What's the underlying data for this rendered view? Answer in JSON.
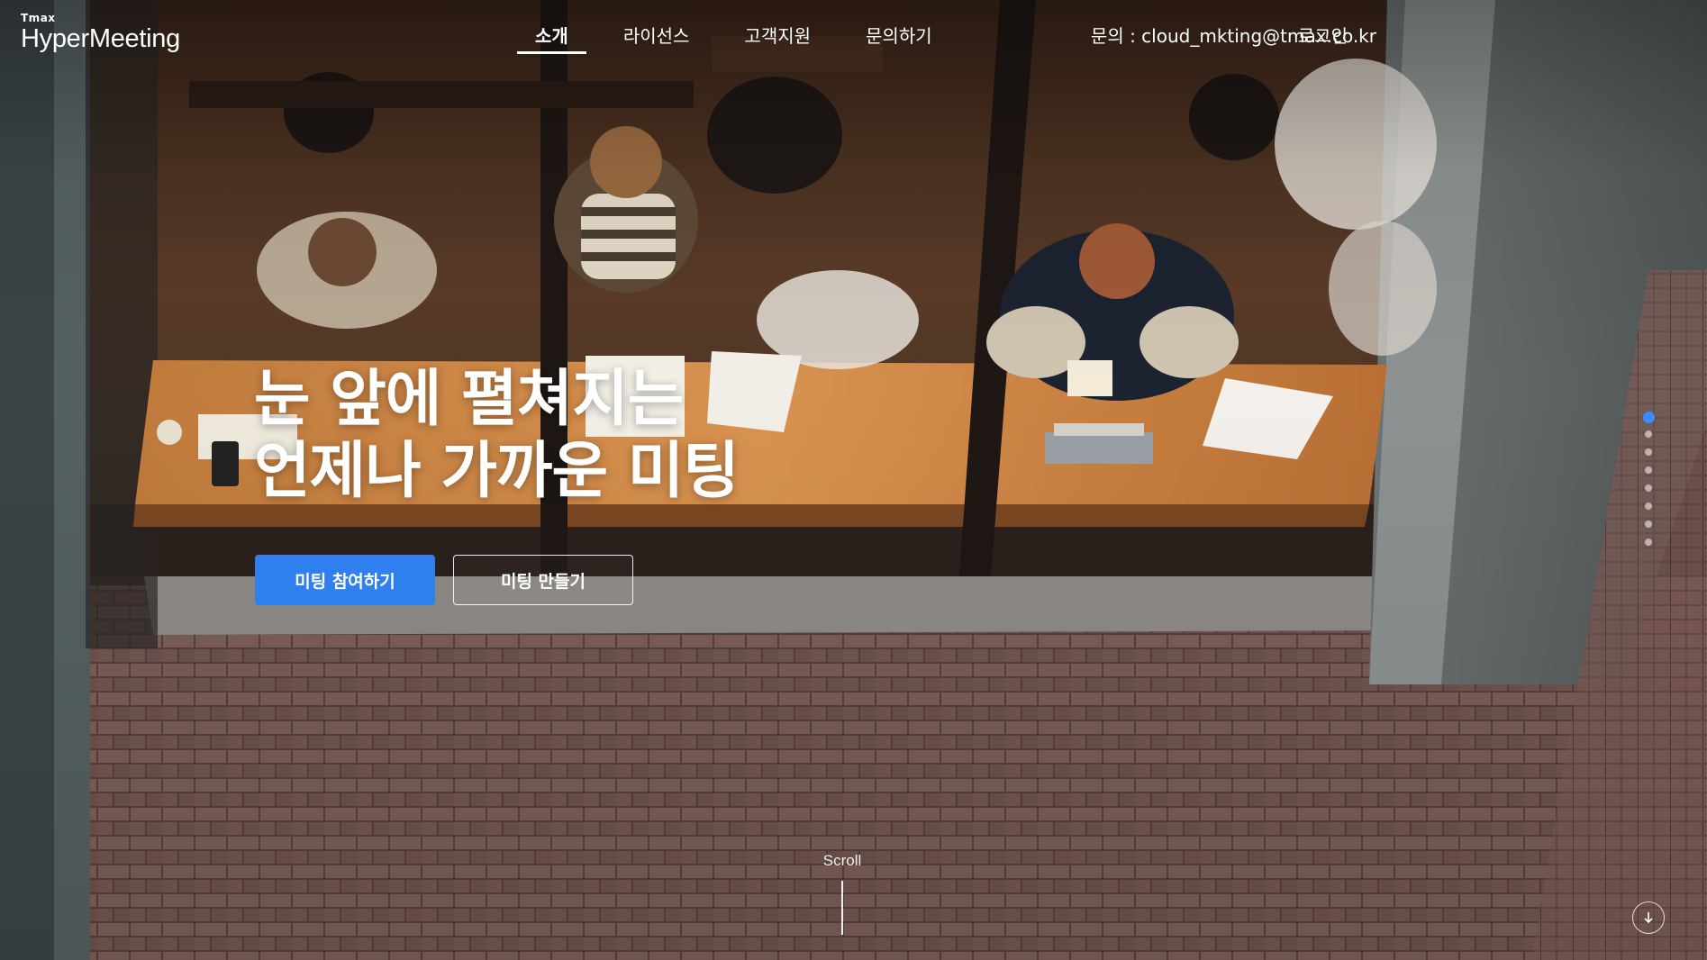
{
  "brand": {
    "small": "Tmax",
    "main": "HyperMeeting"
  },
  "nav": {
    "items": [
      {
        "label": "소개",
        "active": true
      },
      {
        "label": "라이선스",
        "active": false
      },
      {
        "label": "고객지원",
        "active": false
      },
      {
        "label": "문의하기",
        "active": false
      }
    ]
  },
  "header": {
    "contact": "문의 : cloud_mkting@tmax.co.kr",
    "login": "로그인"
  },
  "hero": {
    "headline_line1": "눈 앞에 펼쳐지는",
    "headline_line2": "언제나 가까운 미팅",
    "join_button": "미팅 참여하기",
    "create_button": "미팅 만들기"
  },
  "pager": {
    "count": 8,
    "active_index": 0,
    "active_color": "#3b8cff"
  },
  "scroll": {
    "label": "Scroll"
  },
  "icons": {
    "down": "arrow-down-circle-icon"
  },
  "colors": {
    "primary": "#2f80ed"
  }
}
